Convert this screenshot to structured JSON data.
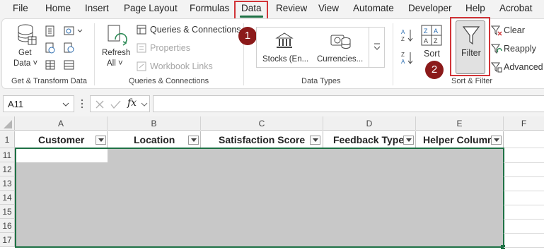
{
  "menu": [
    "File",
    "Home",
    "Insert",
    "Page Layout",
    "Formulas",
    "Data",
    "Review",
    "View",
    "Automate",
    "Developer",
    "Help",
    "Acrobat"
  ],
  "ribbon": {
    "get_data": {
      "line1": "Get",
      "line2": "Data ˅"
    },
    "refresh": {
      "line1": "Refresh",
      "line2": "All ˅"
    },
    "queries_connections": "Queries & Connections",
    "properties": "Properties",
    "workbook_links": "Workbook Links",
    "stocks": "Stocks (En...",
    "currencies": "Currencies...",
    "sort": "Sort",
    "filter": "Filter",
    "clear": "Clear",
    "reapply": "Reapply",
    "advanced": "Advanced",
    "groups": {
      "get_transform": "Get & Transform Data",
      "queries": "Queries & Connections",
      "data_types": "Data Types",
      "sort_filter": "Sort & Filter"
    }
  },
  "badges": {
    "step1": "1",
    "step2": "2"
  },
  "formula_bar": {
    "name_box": "A11",
    "fx": "fx",
    "formula": ""
  },
  "columns": [
    "A",
    "B",
    "C",
    "D",
    "E",
    "F"
  ],
  "table_headers": [
    "Customer",
    "Location",
    "Satisfaction Score",
    "Feedback Type",
    "Helper Column"
  ],
  "row_numbers": [
    "1",
    "11",
    "12",
    "13",
    "14",
    "15",
    "16",
    "17"
  ],
  "colors": {
    "accent": "#1e7145",
    "highlight_box": "#d13438",
    "badge": "#8b1a1a",
    "filtered_area": "#c8c8c8"
  }
}
